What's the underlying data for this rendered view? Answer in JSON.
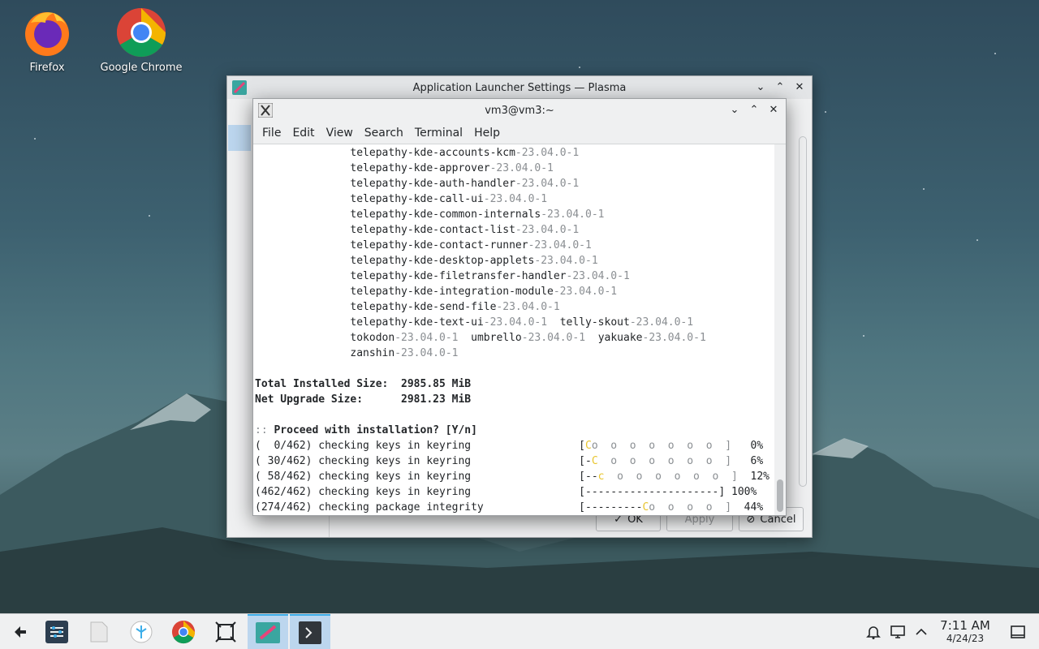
{
  "desktop": {
    "icons": [
      {
        "label": "Firefox"
      },
      {
        "label": "Google Chrome"
      }
    ]
  },
  "settings_window": {
    "title": "Application Launcher Settings — Plasma",
    "ok_label": "OK",
    "apply_label": "Apply",
    "cancel_label": "Cancel"
  },
  "terminal": {
    "title": "vm3@vm3:~",
    "menu": [
      "File",
      "Edit",
      "View",
      "Search",
      "Terminal",
      "Help"
    ],
    "package_lines": [
      [
        {
          "n": "telepathy-kde-accounts-kcm",
          "v": "-23.04.0-1"
        }
      ],
      [
        {
          "n": "telepathy-kde-approver",
          "v": "-23.04.0-1"
        }
      ],
      [
        {
          "n": "telepathy-kde-auth-handler",
          "v": "-23.04.0-1"
        }
      ],
      [
        {
          "n": "telepathy-kde-call-ui",
          "v": "-23.04.0-1"
        }
      ],
      [
        {
          "n": "telepathy-kde-common-internals",
          "v": "-23.04.0-1"
        }
      ],
      [
        {
          "n": "telepathy-kde-contact-list",
          "v": "-23.04.0-1"
        }
      ],
      [
        {
          "n": "telepathy-kde-contact-runner",
          "v": "-23.04.0-1"
        }
      ],
      [
        {
          "n": "telepathy-kde-desktop-applets",
          "v": "-23.04.0-1"
        }
      ],
      [
        {
          "n": "telepathy-kde-filetransfer-handler",
          "v": "-23.04.0-1"
        }
      ],
      [
        {
          "n": "telepathy-kde-integration-module",
          "v": "-23.04.0-1"
        }
      ],
      [
        {
          "n": "telepathy-kde-send-file",
          "v": "-23.04.0-1"
        }
      ],
      [
        {
          "n": "telepathy-kde-text-ui",
          "v": "-23.04.0-1"
        },
        {
          "n": "telly-skout",
          "v": "-23.04.0-1"
        }
      ],
      [
        {
          "n": "tokodon",
          "v": "-23.04.0-1"
        },
        {
          "n": "umbrello",
          "v": "-23.04.0-1"
        },
        {
          "n": "yakuake",
          "v": "-23.04.0-1"
        }
      ],
      [
        {
          "n": "zanshin",
          "v": "-23.04.0-1"
        }
      ]
    ],
    "total_installed_label": "Total Installed Size:",
    "total_installed_value": "2985.85 MiB",
    "net_upgrade_label": "Net Upgrade Size:",
    "net_upgrade_value": "2981.23 MiB",
    "prompt_prefix": "::",
    "prompt_text": "Proceed with installation? [Y/n]",
    "progress": [
      {
        "count": "(  0/462)",
        "task": "checking keys in keyring",
        "bar_pre": "[",
        "bar_pac": "C",
        "bar_post": "o  o  o  o  o  o  o  ]",
        "percent": "0%"
      },
      {
        "count": "( 30/462)",
        "task": "checking keys in keyring",
        "bar_pre": "[-",
        "bar_pac": "C",
        "bar_post": "  o  o  o  o  o  o  ]",
        "percent": "6%"
      },
      {
        "count": "( 58/462)",
        "task": "checking keys in keyring",
        "bar_pre": "[--",
        "bar_pac": "c",
        "bar_post": "  o  o  o  o  o  o  ]",
        "percent": "12%"
      },
      {
        "count": "(462/462)",
        "task": "checking keys in keyring",
        "bar_pre": "[---------------------]",
        "bar_pac": "",
        "bar_post": "",
        "percent": "100%"
      },
      {
        "count": "(274/462)",
        "task": "checking package integrity",
        "bar_pre": "[---------",
        "bar_pac": "C",
        "bar_post": "o  o  o  o  ]",
        "percent": "44%"
      }
    ]
  },
  "taskbar": {
    "time": "7:11 AM",
    "date": "4/24/23",
    "icons": [
      "launcher-icon",
      "settings-icon",
      "files-icon",
      "discover-icon",
      "chrome-icon",
      "screenshot-icon",
      "plasma-settings-icon",
      "terminal-icon"
    ],
    "tray_icons": [
      "notifications-icon",
      "display-icon",
      "expand-tray-icon",
      "show-desktop-icon"
    ]
  }
}
